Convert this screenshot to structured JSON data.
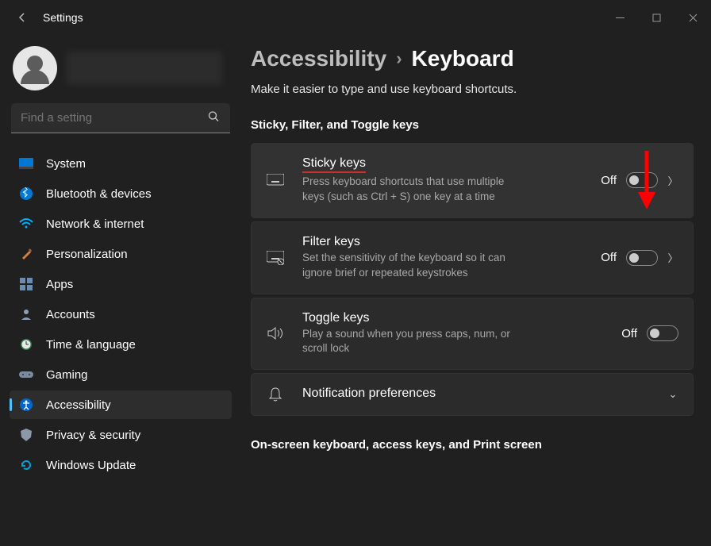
{
  "window": {
    "title": "Settings"
  },
  "search": {
    "placeholder": "Find a setting"
  },
  "sidebar": {
    "items": [
      {
        "label": "System"
      },
      {
        "label": "Bluetooth & devices"
      },
      {
        "label": "Network & internet"
      },
      {
        "label": "Personalization"
      },
      {
        "label": "Apps"
      },
      {
        "label": "Accounts"
      },
      {
        "label": "Time & language"
      },
      {
        "label": "Gaming"
      },
      {
        "label": "Accessibility"
      },
      {
        "label": "Privacy & security"
      },
      {
        "label": "Windows Update"
      }
    ]
  },
  "breadcrumb": {
    "parent": "Accessibility",
    "current": "Keyboard"
  },
  "subtitle": "Make it easier to type and use keyboard shortcuts.",
  "section1_header": "Sticky, Filter, and Toggle keys",
  "cards": {
    "sticky": {
      "title": "Sticky keys",
      "desc": "Press keyboard shortcuts that use multiple keys (such as Ctrl + S) one key at a time",
      "state": "Off"
    },
    "filter": {
      "title": "Filter keys",
      "desc": "Set the sensitivity of the keyboard so it can ignore brief or repeated keystrokes",
      "state": "Off"
    },
    "togglekeys": {
      "title": "Toggle keys",
      "desc": "Play a sound when you press caps, num, or scroll lock",
      "state": "Off"
    },
    "notif": {
      "title": "Notification preferences"
    }
  },
  "section2_header": "On-screen keyboard, access keys, and Print screen"
}
